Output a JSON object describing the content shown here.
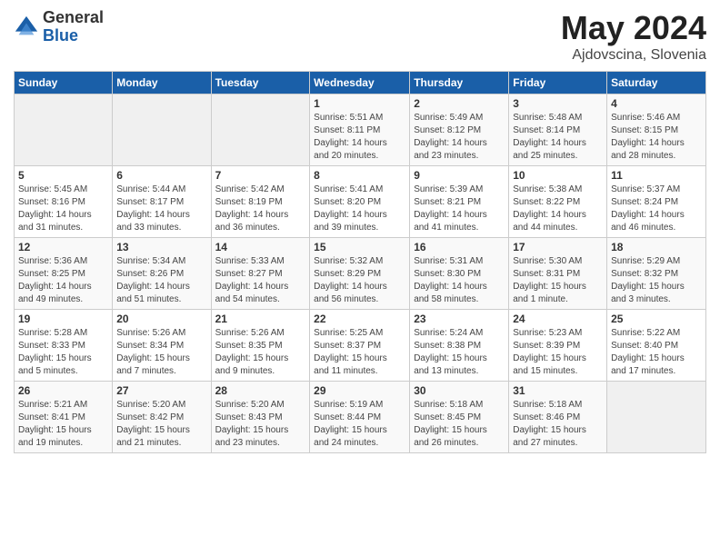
{
  "logo": {
    "general": "General",
    "blue": "Blue"
  },
  "title": {
    "month_year": "May 2024",
    "location": "Ajdovscina, Slovenia"
  },
  "days_of_week": [
    "Sunday",
    "Monday",
    "Tuesday",
    "Wednesday",
    "Thursday",
    "Friday",
    "Saturday"
  ],
  "weeks": [
    [
      {
        "day": "",
        "info": ""
      },
      {
        "day": "",
        "info": ""
      },
      {
        "day": "",
        "info": ""
      },
      {
        "day": "1",
        "info": "Sunrise: 5:51 AM\nSunset: 8:11 PM\nDaylight: 14 hours\nand 20 minutes."
      },
      {
        "day": "2",
        "info": "Sunrise: 5:49 AM\nSunset: 8:12 PM\nDaylight: 14 hours\nand 23 minutes."
      },
      {
        "day": "3",
        "info": "Sunrise: 5:48 AM\nSunset: 8:14 PM\nDaylight: 14 hours\nand 25 minutes."
      },
      {
        "day": "4",
        "info": "Sunrise: 5:46 AM\nSunset: 8:15 PM\nDaylight: 14 hours\nand 28 minutes."
      }
    ],
    [
      {
        "day": "5",
        "info": "Sunrise: 5:45 AM\nSunset: 8:16 PM\nDaylight: 14 hours\nand 31 minutes."
      },
      {
        "day": "6",
        "info": "Sunrise: 5:44 AM\nSunset: 8:17 PM\nDaylight: 14 hours\nand 33 minutes."
      },
      {
        "day": "7",
        "info": "Sunrise: 5:42 AM\nSunset: 8:19 PM\nDaylight: 14 hours\nand 36 minutes."
      },
      {
        "day": "8",
        "info": "Sunrise: 5:41 AM\nSunset: 8:20 PM\nDaylight: 14 hours\nand 39 minutes."
      },
      {
        "day": "9",
        "info": "Sunrise: 5:39 AM\nSunset: 8:21 PM\nDaylight: 14 hours\nand 41 minutes."
      },
      {
        "day": "10",
        "info": "Sunrise: 5:38 AM\nSunset: 8:22 PM\nDaylight: 14 hours\nand 44 minutes."
      },
      {
        "day": "11",
        "info": "Sunrise: 5:37 AM\nSunset: 8:24 PM\nDaylight: 14 hours\nand 46 minutes."
      }
    ],
    [
      {
        "day": "12",
        "info": "Sunrise: 5:36 AM\nSunset: 8:25 PM\nDaylight: 14 hours\nand 49 minutes."
      },
      {
        "day": "13",
        "info": "Sunrise: 5:34 AM\nSunset: 8:26 PM\nDaylight: 14 hours\nand 51 minutes."
      },
      {
        "day": "14",
        "info": "Sunrise: 5:33 AM\nSunset: 8:27 PM\nDaylight: 14 hours\nand 54 minutes."
      },
      {
        "day": "15",
        "info": "Sunrise: 5:32 AM\nSunset: 8:29 PM\nDaylight: 14 hours\nand 56 minutes."
      },
      {
        "day": "16",
        "info": "Sunrise: 5:31 AM\nSunset: 8:30 PM\nDaylight: 14 hours\nand 58 minutes."
      },
      {
        "day": "17",
        "info": "Sunrise: 5:30 AM\nSunset: 8:31 PM\nDaylight: 15 hours\nand 1 minute."
      },
      {
        "day": "18",
        "info": "Sunrise: 5:29 AM\nSunset: 8:32 PM\nDaylight: 15 hours\nand 3 minutes."
      }
    ],
    [
      {
        "day": "19",
        "info": "Sunrise: 5:28 AM\nSunset: 8:33 PM\nDaylight: 15 hours\nand 5 minutes."
      },
      {
        "day": "20",
        "info": "Sunrise: 5:26 AM\nSunset: 8:34 PM\nDaylight: 15 hours\nand 7 minutes."
      },
      {
        "day": "21",
        "info": "Sunrise: 5:26 AM\nSunset: 8:35 PM\nDaylight: 15 hours\nand 9 minutes."
      },
      {
        "day": "22",
        "info": "Sunrise: 5:25 AM\nSunset: 8:37 PM\nDaylight: 15 hours\nand 11 minutes."
      },
      {
        "day": "23",
        "info": "Sunrise: 5:24 AM\nSunset: 8:38 PM\nDaylight: 15 hours\nand 13 minutes."
      },
      {
        "day": "24",
        "info": "Sunrise: 5:23 AM\nSunset: 8:39 PM\nDaylight: 15 hours\nand 15 minutes."
      },
      {
        "day": "25",
        "info": "Sunrise: 5:22 AM\nSunset: 8:40 PM\nDaylight: 15 hours\nand 17 minutes."
      }
    ],
    [
      {
        "day": "26",
        "info": "Sunrise: 5:21 AM\nSunset: 8:41 PM\nDaylight: 15 hours\nand 19 minutes."
      },
      {
        "day": "27",
        "info": "Sunrise: 5:20 AM\nSunset: 8:42 PM\nDaylight: 15 hours\nand 21 minutes."
      },
      {
        "day": "28",
        "info": "Sunrise: 5:20 AM\nSunset: 8:43 PM\nDaylight: 15 hours\nand 23 minutes."
      },
      {
        "day": "29",
        "info": "Sunrise: 5:19 AM\nSunset: 8:44 PM\nDaylight: 15 hours\nand 24 minutes."
      },
      {
        "day": "30",
        "info": "Sunrise: 5:18 AM\nSunset: 8:45 PM\nDaylight: 15 hours\nand 26 minutes."
      },
      {
        "day": "31",
        "info": "Sunrise: 5:18 AM\nSunset: 8:46 PM\nDaylight: 15 hours\nand 27 minutes."
      },
      {
        "day": "",
        "info": ""
      }
    ]
  ]
}
